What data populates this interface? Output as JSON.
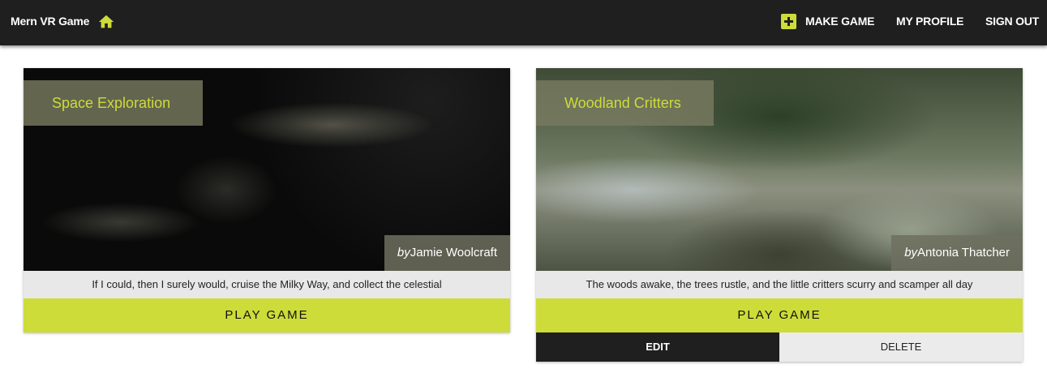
{
  "appbar": {
    "title": "Mern VR Game",
    "home_icon": "home-icon",
    "make_game_icon": "add-box-icon",
    "make_game_label": "MAKE GAME",
    "my_profile_label": "MY PROFILE",
    "sign_out_label": "SIGN OUT",
    "accent_color": "#cddc39"
  },
  "games": [
    {
      "title": "Space Exploration",
      "by": "by",
      "author": "Jamie Woolcraft",
      "description": "If I could, then I surely would, cruise the Milky Way, and collect the celestial",
      "play_label": "PLAY GAME"
    },
    {
      "title": "Woodland Critters",
      "by": "by",
      "author": "Antonia Thatcher",
      "description": "The woods awake, the trees rustle, and the little critters scurry and scamper all day",
      "play_label": "PLAY GAME",
      "edit_label": "EDIT",
      "delete_label": "DELETE"
    }
  ]
}
